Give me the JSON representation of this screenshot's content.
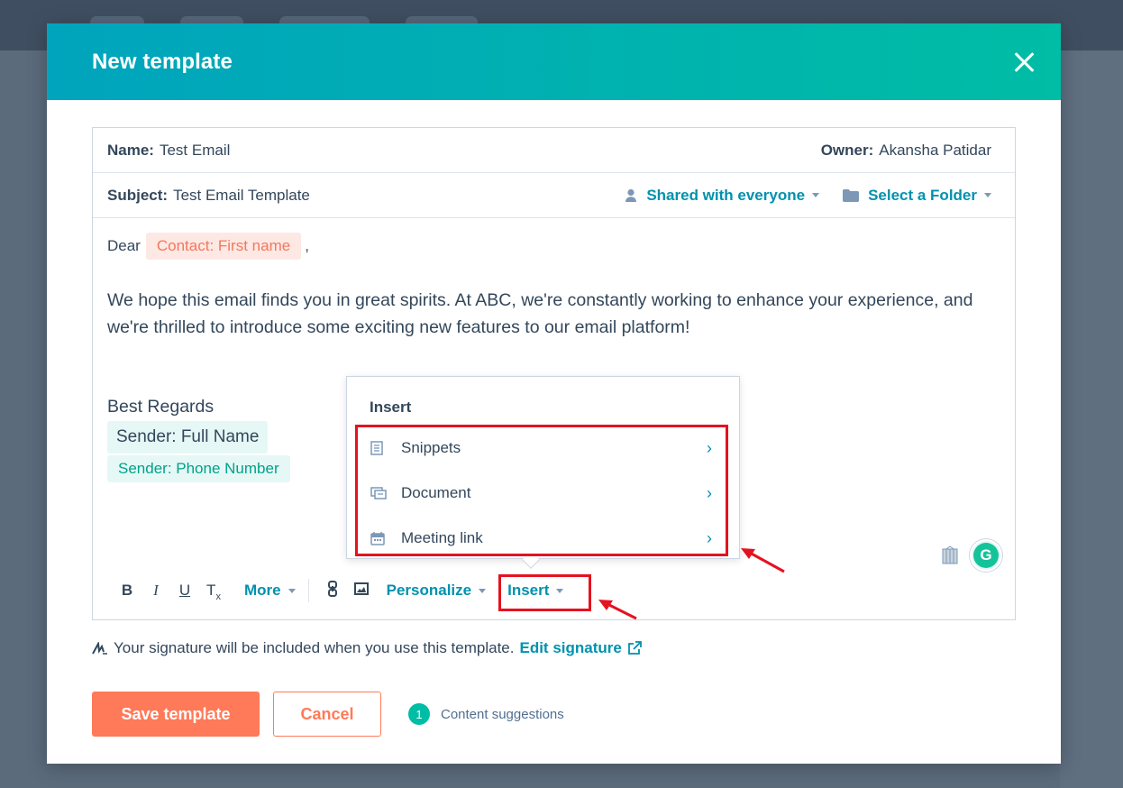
{
  "modal": {
    "title": "New template"
  },
  "meta": {
    "name_label": "Name:",
    "name_value": "Test Email",
    "owner_label": "Owner:",
    "owner_value": "Akansha Patidar",
    "subject_label": "Subject:",
    "subject_value": "Test Email Template",
    "shared_label": "Shared with everyone",
    "folder_label": "Select a Folder"
  },
  "body": {
    "greeting": "Dear",
    "contact_token": "Contact: First name",
    "comma": ",",
    "paragraph": "We hope this email finds you in great spirits. At ABC, we're constantly working to enhance your experience, and we're thrilled to introduce some exciting new features to our email platform!",
    "closing": "Best Regards",
    "sender_name_token": "Sender: Full Name",
    "sender_phone_token": "Sender: Phone Number"
  },
  "toolbar": {
    "bold": "B",
    "italic": "I",
    "underline": "U",
    "clear_format": "T",
    "more_label": "More",
    "personalize_label": "Personalize",
    "insert_label": "Insert"
  },
  "insert_menu": {
    "title": "Insert",
    "items": [
      {
        "label": "Snippets",
        "icon": "snippet-icon"
      },
      {
        "label": "Document",
        "icon": "document-icon"
      },
      {
        "label": "Meeting link",
        "icon": "calendar-icon"
      }
    ]
  },
  "footer": {
    "signature_text": "Your signature will be included when you use this template.",
    "edit_signature_label": "Edit signature",
    "save_label": "Save template",
    "cancel_label": "Cancel",
    "suggestions_count": "1",
    "suggestions_label": "Content suggestions"
  },
  "colors": {
    "header_start": "#00a4bd",
    "header_end": "#00bda5",
    "accent_link": "#0091ae",
    "primary_button": "#ff7a59",
    "annotation_red": "#e5121f"
  }
}
